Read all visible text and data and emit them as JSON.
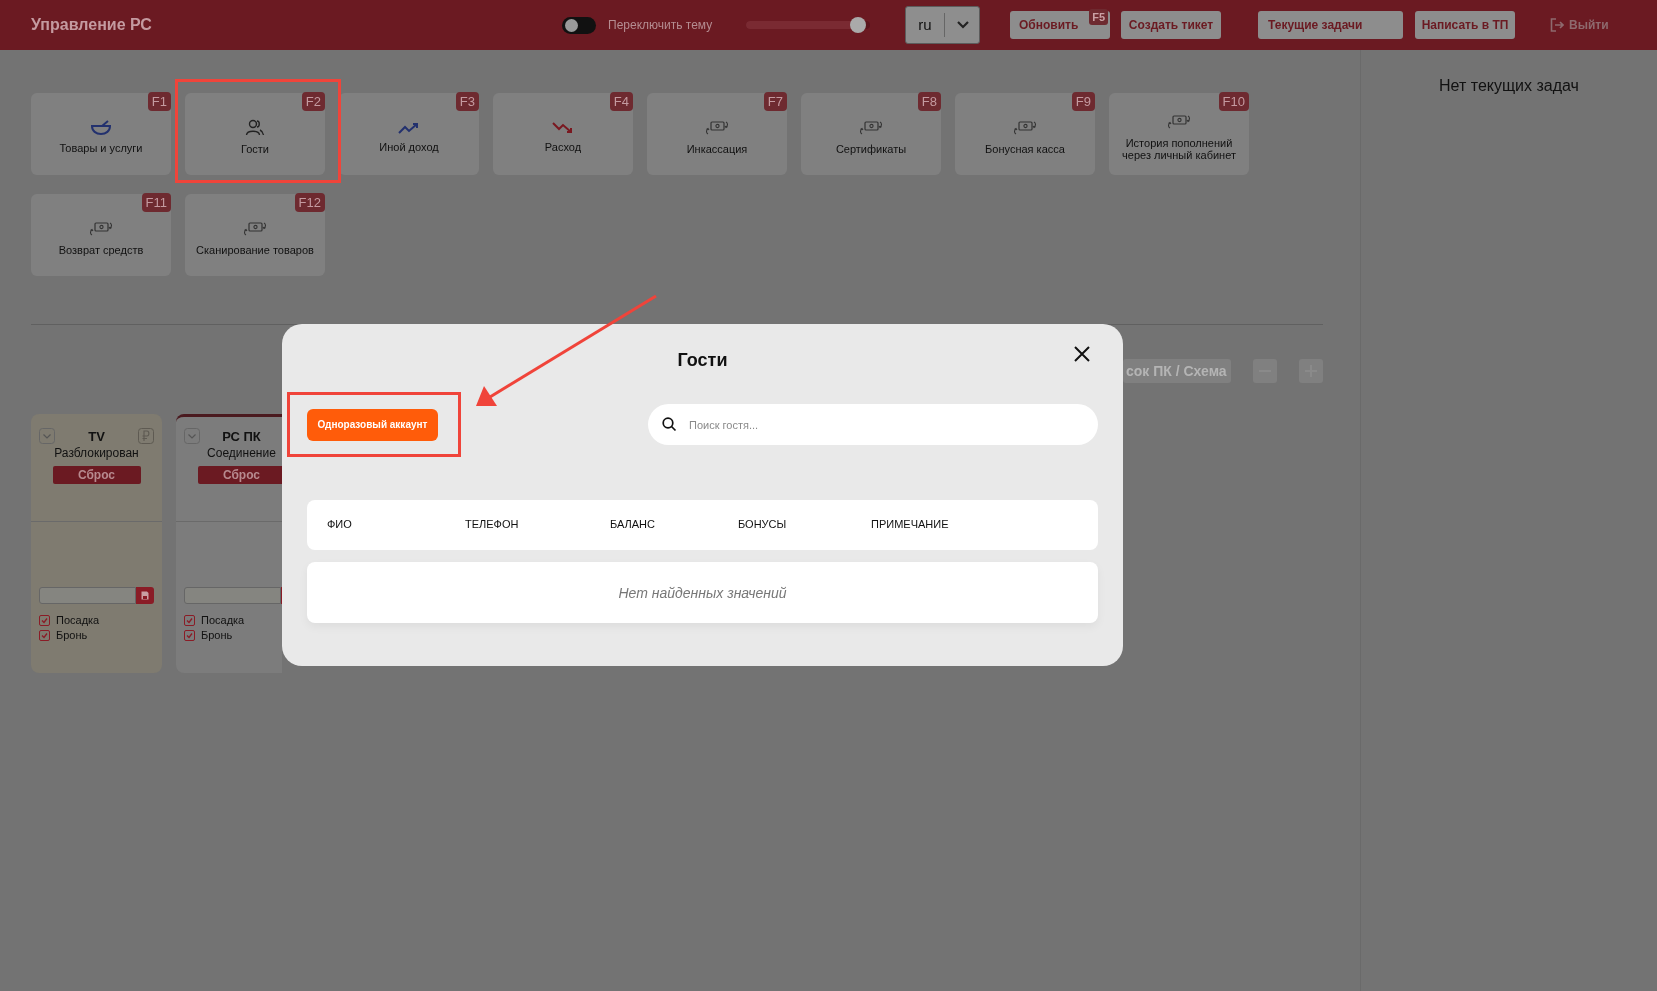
{
  "header": {
    "title": "Управление РС",
    "theme_toggle": {
      "label": "Переключить тему",
      "on": false
    },
    "slider": {
      "level": 0.9
    },
    "language": "ru",
    "buttons": [
      {
        "label": "Обновить",
        "hotkey": "F5"
      },
      {
        "label": "Создать тикет"
      },
      {
        "label": "Текущие задачи"
      },
      {
        "label": "Написать в ТП"
      }
    ],
    "logout": "Выйти"
  },
  "tasks_panel": {
    "text": "Нет текущих задач"
  },
  "tiles": [
    {
      "label": "Товары и услуги",
      "hotkey": "F1",
      "kind": "bowl"
    },
    {
      "label": "Гости",
      "hotkey": "F2",
      "kind": "guests"
    },
    {
      "label": "Иной доход",
      "hotkey": "F3",
      "kind": "income"
    },
    {
      "label": "Расход",
      "hotkey": "F4",
      "kind": "expense"
    },
    {
      "label": "Инкассация",
      "hotkey": "F7",
      "kind": "money"
    },
    {
      "label": "Сертификаты",
      "hotkey": "F8",
      "kind": "money"
    },
    {
      "label": "Бонусная касса",
      "hotkey": "F9",
      "kind": "money"
    },
    {
      "label": "История пополнений через личный кабинет",
      "hotkey": "F10",
      "kind": "money"
    },
    {
      "label": "Возврат средств",
      "hotkey": "F11",
      "kind": "money"
    },
    {
      "label": "Сканирование товаров",
      "hotkey": "F12",
      "kind": "money"
    }
  ],
  "view_switch": {
    "label": "сок ПК / Схема"
  },
  "pc_cards": [
    {
      "name": "TV",
      "status": "Разблокирован",
      "reset": "Сброс",
      "kind": "unlocked",
      "options": [
        {
          "label": "Посадка",
          "checked": true
        },
        {
          "label": "Бронь",
          "checked": true
        }
      ]
    },
    {
      "name": "РС ПК",
      "status": "Соединение",
      "reset": "Сброс",
      "kind": "connecting",
      "options": [
        {
          "label": "Посадка",
          "checked": true
        },
        {
          "label": "Бронь",
          "checked": true
        }
      ]
    }
  ],
  "modal": {
    "title": "Гости",
    "one_time_button": "Одноразовый аккаунт",
    "search": {
      "placeholder": "Поиск гостя..."
    },
    "columns": [
      "ФИО",
      "ТЕЛЕФОН",
      "БАЛАНС",
      "БОНУСЫ",
      "ПРИМЕЧАНИЕ"
    ],
    "empty_text": "Нет найденных значений"
  }
}
